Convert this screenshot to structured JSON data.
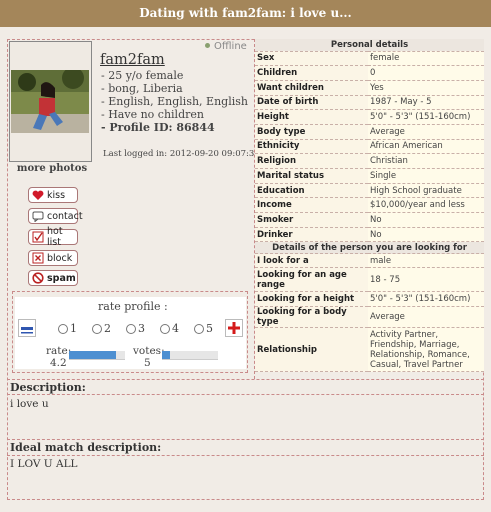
{
  "title": "Dating with fam2fam: i love u...",
  "profile": {
    "status": "Offline",
    "username": "fam2fam",
    "info": [
      "- 25 y/o female",
      "- bong, Liberia",
      "- English, English, English",
      "- Have no children"
    ],
    "profile_id": "- Profile ID: 86844",
    "last_logged": "Last logged in: 2012-09-20 09:07:30",
    "more_photos": "more photos"
  },
  "actions": [
    {
      "label": "kiss",
      "icon": "heart-icon"
    },
    {
      "label": "contact",
      "icon": "speech-bubble-icon"
    },
    {
      "label": "hot list",
      "icon": "checkbox-icon"
    },
    {
      "label": "block",
      "icon": "x-box-icon"
    },
    {
      "label": "spam",
      "icon": "prohibited-icon"
    }
  ],
  "rating": {
    "title": "rate profile :",
    "options": [
      "1",
      "2",
      "3",
      "4",
      "5"
    ],
    "rate_label": "rate:",
    "rate_value": "4.2",
    "votes_label": "votes:",
    "votes_value": "5",
    "rate_fraction": 0.84,
    "votes_fraction": 0.14
  },
  "personal_details": {
    "header": "Personal details",
    "rows": [
      {
        "k": "Sex",
        "v": "female"
      },
      {
        "k": "Children",
        "v": "0"
      },
      {
        "k": "Want children",
        "v": "Yes"
      },
      {
        "k": "Date of birth",
        "v": "1987 - May - 5"
      },
      {
        "k": "Height",
        "v": "5'0\" - 5'3\" (151-160cm)"
      },
      {
        "k": "Body type",
        "v": "Average"
      },
      {
        "k": "Ethnicity",
        "v": "African American"
      },
      {
        "k": "Religion",
        "v": "Christian"
      },
      {
        "k": "Marital status",
        "v": "Single"
      },
      {
        "k": "Education",
        "v": "High School graduate"
      },
      {
        "k": "Income",
        "v": "$10,000/year and less"
      },
      {
        "k": "Smoker",
        "v": "No"
      },
      {
        "k": "Drinker",
        "v": "No"
      }
    ]
  },
  "looking_for": {
    "header": "Details of the person you are looking for",
    "rows": [
      {
        "k": "I look for a",
        "v": "male"
      },
      {
        "k": "Looking for an age range",
        "v": "18 -  75"
      },
      {
        "k": "Looking for a height",
        "v": "5'0\" - 5'3\" (151-160cm)"
      },
      {
        "k": "Looking for a body type",
        "v": "Average"
      },
      {
        "k": "Relationship",
        "v": "Activity Partner, Friendship, Marriage, Relationship, Romance, Casual, Travel Partner"
      }
    ]
  },
  "description": {
    "label": "Description:",
    "text": "i love u"
  },
  "ideal_match": {
    "label": "Ideal match description:",
    "text": "I LOV U ALL"
  },
  "colors": {
    "titlebar": "#a4865a",
    "border": "#c98a8a",
    "bar_fill": "#4d8fd1"
  }
}
